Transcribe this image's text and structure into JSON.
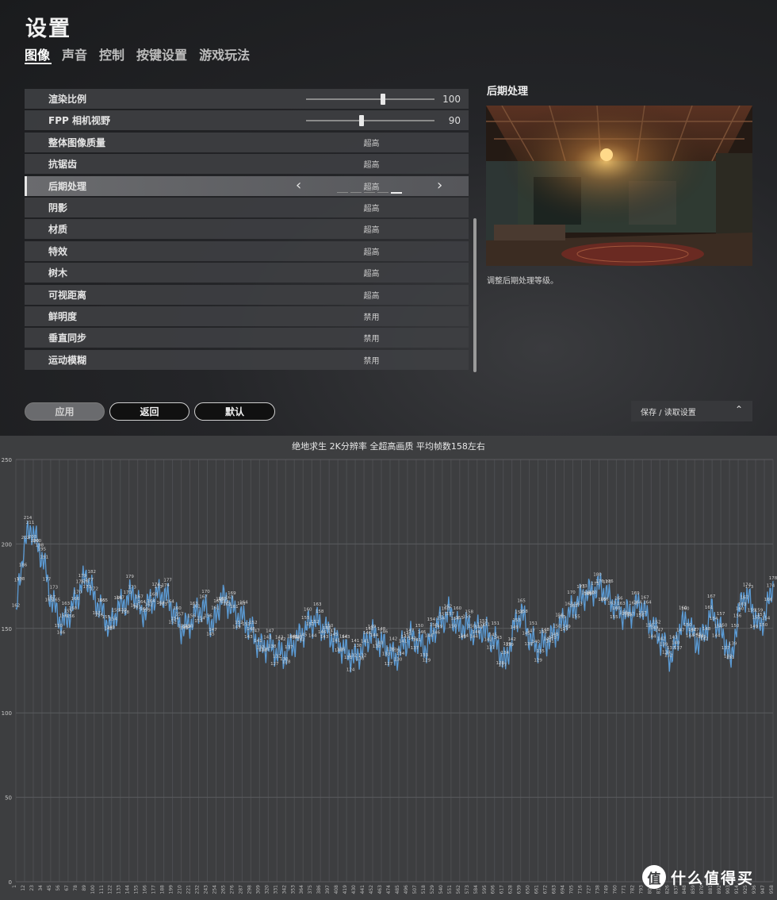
{
  "game": {
    "title": "设置",
    "tabs": [
      {
        "label": "图像",
        "active": true
      },
      {
        "label": "声音",
        "active": false
      },
      {
        "label": "控制",
        "active": false
      },
      {
        "label": "按键设置",
        "active": false
      },
      {
        "label": "游戏玩法",
        "active": false
      }
    ],
    "settings": [
      {
        "label": "渲染比例",
        "type": "slider",
        "value": "100",
        "fraction": 0.6
      },
      {
        "label": "FPP 相机视野",
        "type": "slider",
        "value": "90",
        "fraction": 0.43
      },
      {
        "label": "整体图像质量",
        "type": "option",
        "value": "超高"
      },
      {
        "label": "抗锯齿",
        "type": "option",
        "value": "超高"
      },
      {
        "label": "后期处理",
        "type": "option",
        "value": "超高",
        "selected": true,
        "level": 5,
        "levels": 5
      },
      {
        "label": "阴影",
        "type": "option",
        "value": "超高"
      },
      {
        "label": "材质",
        "type": "option",
        "value": "超高"
      },
      {
        "label": "特效",
        "type": "option",
        "value": "超高"
      },
      {
        "label": "树木",
        "type": "option",
        "value": "超高"
      },
      {
        "label": "可视距离",
        "type": "option",
        "value": "超高"
      },
      {
        "label": "鲜明度",
        "type": "option",
        "value": "禁用"
      },
      {
        "label": "垂直同步",
        "type": "option",
        "value": "禁用"
      },
      {
        "label": "运动模糊",
        "type": "option",
        "value": "禁用"
      }
    ],
    "preview_title": "后期处理",
    "preview_desc": "调整后期处理等级。",
    "buttons": {
      "apply": "应用",
      "back": "返回",
      "default": "默认"
    },
    "save_load": "保存 / 读取设置",
    "icons": {
      "prev": "chevron-left-icon",
      "next": "chevron-right-icon",
      "saveload": "chevron-up-icon"
    }
  },
  "chart_data": {
    "type": "line",
    "title": "绝地求生 2K分辨率 全超高画质 平均帧数158左右",
    "ylim": [
      0,
      250
    ],
    "yticks": [
      0,
      50,
      100,
      150,
      200,
      250
    ],
    "x_tick_step": 11,
    "x_max": 958,
    "grid": true,
    "series_color": "#5b9bd5",
    "keypoints": [
      [
        1,
        154
      ],
      [
        5,
        176
      ],
      [
        10,
        195
      ],
      [
        15,
        204
      ],
      [
        20,
        210
      ],
      [
        28,
        200
      ],
      [
        36,
        190
      ],
      [
        44,
        170
      ],
      [
        52,
        160
      ],
      [
        60,
        152
      ],
      [
        70,
        160
      ],
      [
        80,
        170
      ],
      [
        90,
        182
      ],
      [
        100,
        168
      ],
      [
        110,
        160
      ],
      [
        120,
        150
      ],
      [
        130,
        162
      ],
      [
        140,
        166
      ],
      [
        150,
        172
      ],
      [
        160,
        158
      ],
      [
        170,
        165
      ],
      [
        180,
        170
      ],
      [
        190,
        170
      ],
      [
        200,
        160
      ],
      [
        210,
        150
      ],
      [
        220,
        152
      ],
      [
        230,
        160
      ],
      [
        240,
        162
      ],
      [
        250,
        150
      ],
      [
        260,
        168
      ],
      [
        270,
        165
      ],
      [
        280,
        158
      ],
      [
        290,
        155
      ],
      [
        300,
        148
      ],
      [
        310,
        138
      ],
      [
        320,
        140
      ],
      [
        330,
        136
      ],
      [
        340,
        134
      ],
      [
        350,
        140
      ],
      [
        360,
        145
      ],
      [
        370,
        152
      ],
      [
        380,
        155
      ],
      [
        390,
        150
      ],
      [
        400,
        145
      ],
      [
        410,
        140
      ],
      [
        420,
        135
      ],
      [
        430,
        132
      ],
      [
        440,
        138
      ],
      [
        450,
        148
      ],
      [
        460,
        142
      ],
      [
        470,
        138
      ],
      [
        480,
        132
      ],
      [
        490,
        140
      ],
      [
        500,
        145
      ],
      [
        510,
        142
      ],
      [
        520,
        138
      ],
      [
        530,
        150
      ],
      [
        540,
        155
      ],
      [
        550,
        160
      ],
      [
        560,
        150
      ],
      [
        570,
        152
      ],
      [
        580,
        148
      ],
      [
        590,
        150
      ],
      [
        600,
        145
      ],
      [
        610,
        140
      ],
      [
        620,
        128
      ],
      [
        630,
        150
      ],
      [
        640,
        160
      ],
      [
        650,
        145
      ],
      [
        660,
        138
      ],
      [
        670,
        142
      ],
      [
        680,
        145
      ],
      [
        690,
        152
      ],
      [
        700,
        158
      ],
      [
        710,
        165
      ],
      [
        720,
        170
      ],
      [
        730,
        172
      ],
      [
        740,
        175
      ],
      [
        750,
        168
      ],
      [
        760,
        162
      ],
      [
        770,
        158
      ],
      [
        780,
        160
      ],
      [
        790,
        165
      ],
      [
        800,
        155
      ],
      [
        810,
        148
      ],
      [
        820,
        140
      ],
      [
        830,
        132
      ],
      [
        840,
        150
      ],
      [
        850,
        155
      ],
      [
        860,
        142
      ],
      [
        870,
        145
      ],
      [
        880,
        160
      ],
      [
        890,
        150
      ],
      [
        900,
        140
      ],
      [
        905,
        128
      ],
      [
        910,
        148
      ],
      [
        920,
        170
      ],
      [
        930,
        165
      ],
      [
        940,
        150
      ],
      [
        950,
        160
      ],
      [
        958,
        178
      ]
    ]
  }
}
